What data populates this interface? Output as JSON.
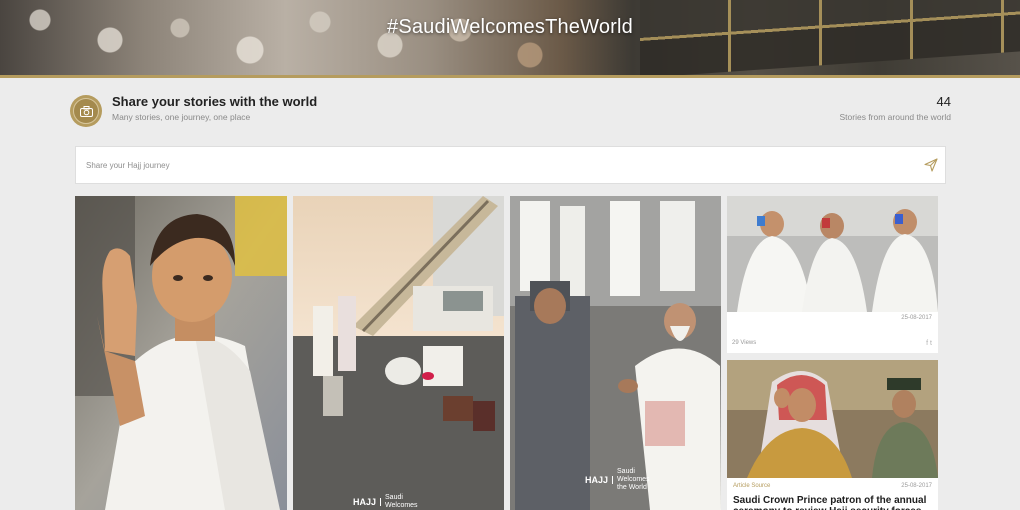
{
  "hero": {
    "hashtag": "#SaudiWelcomesTheWorld"
  },
  "stories": {
    "title": "Share your stories with the world",
    "subtitle": "Many stories, one journey, one place",
    "count": "44",
    "count_label": "Stories from around the world"
  },
  "share": {
    "placeholder": "Share your Hajj journey"
  },
  "watermark": {
    "brand": "HAJJ",
    "line1": "Saudi",
    "line2": "Welcomes",
    "line3": "the World"
  },
  "cards": {
    "pilgrims_drinking": {
      "views": "29 Views",
      "date": "25-08-2017",
      "social": "f  t"
    },
    "article": {
      "source": "Article Source",
      "date": "25-08-2017",
      "title": "Saudi Crown Prince patron of the annual ceremony to review Hajj security forces"
    }
  },
  "colors": {
    "accent": "#b59c5e",
    "background": "#ececec"
  },
  "icons": {
    "camera": "camera-icon",
    "send": "send-icon"
  }
}
